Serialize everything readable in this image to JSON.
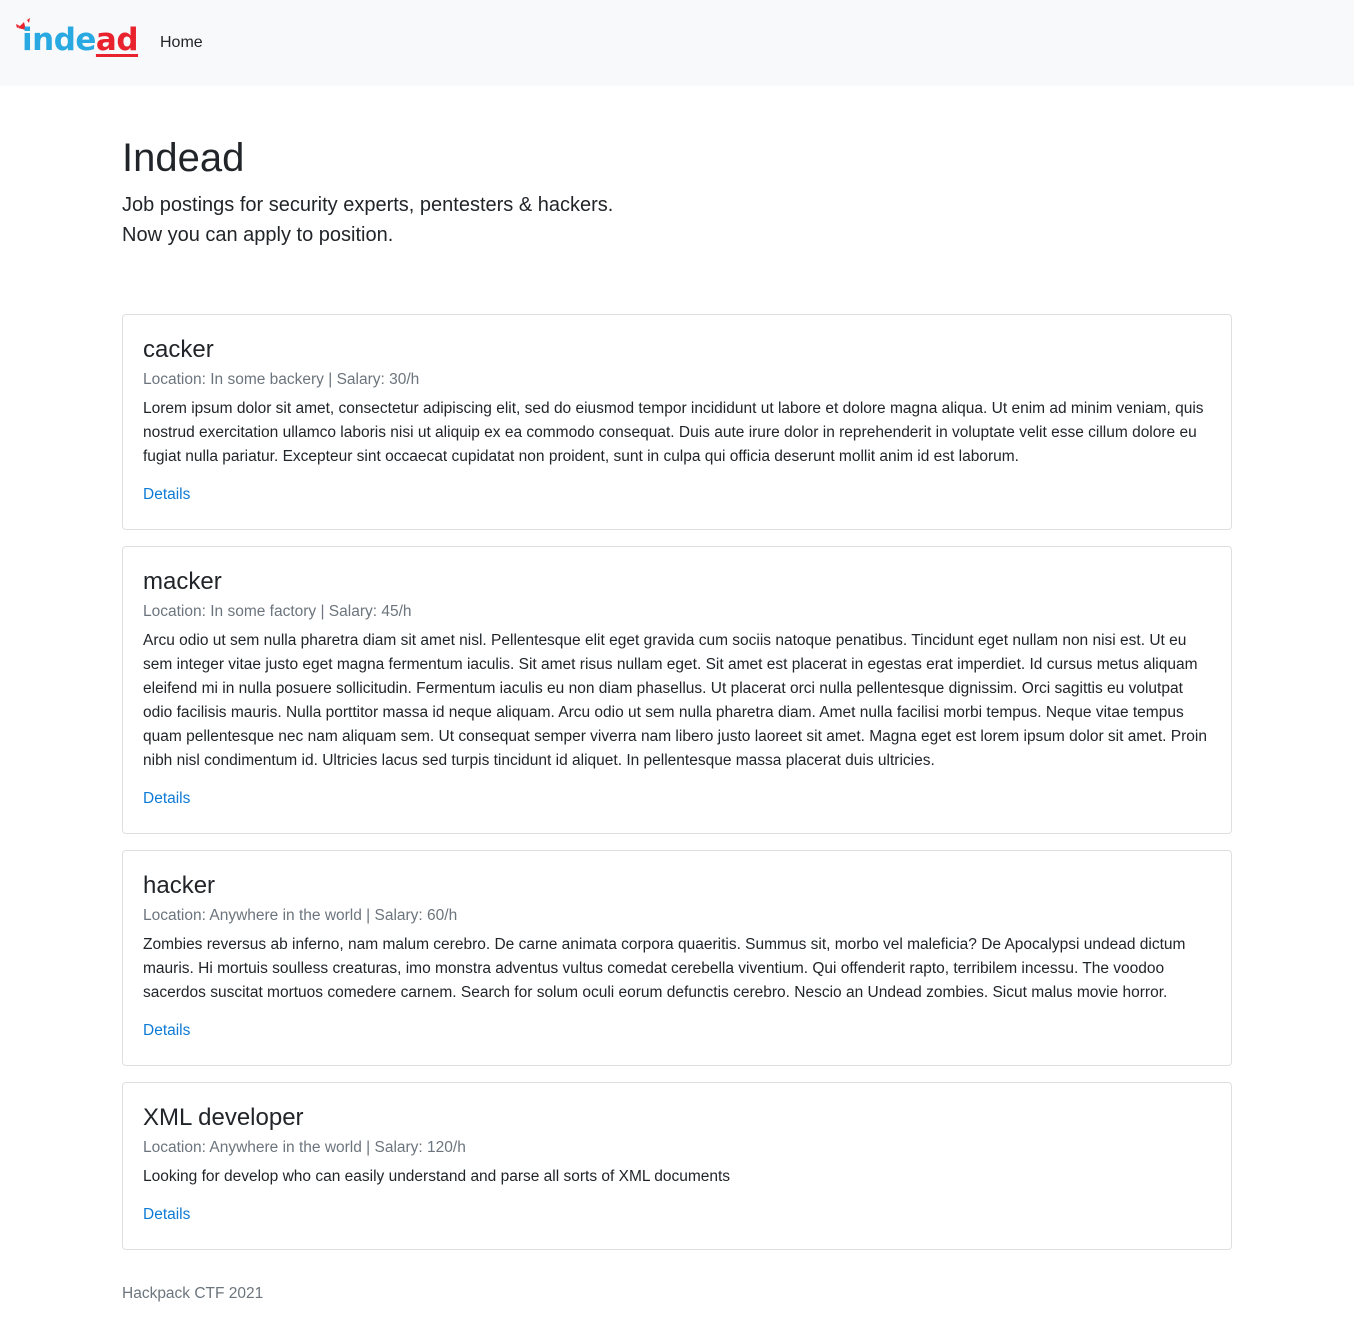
{
  "nav": {
    "brand_part_a": "inde",
    "brand_part_b": "ad",
    "brand_part_c": "",
    "home_label": "Home"
  },
  "header": {
    "title": "Indead",
    "lead_line_1": "Job postings for security experts, pentesters & hackers.",
    "lead_line_2": "Now you can apply to position."
  },
  "jobs": [
    {
      "title": "cacker",
      "meta": "Location: In some backery | Salary: 30/h",
      "description": "Lorem ipsum dolor sit amet, consectetur adipiscing elit, sed do eiusmod tempor incididunt ut labore et dolore magna aliqua. Ut enim ad minim veniam, quis nostrud exercitation ullamco laboris nisi ut aliquip ex ea commodo consequat. Duis aute irure dolor in reprehenderit in voluptate velit esse cillum dolore eu fugiat nulla pariatur. Excepteur sint occaecat cupidatat non proident, sunt in culpa qui officia deserunt mollit anim id est laborum.",
      "link": "Details"
    },
    {
      "title": "macker",
      "meta": "Location: In some factory | Salary: 45/h",
      "description": "Arcu odio ut sem nulla pharetra diam sit amet nisl. Pellentesque elit eget gravida cum sociis natoque penatibus. Tincidunt eget nullam non nisi est. Ut eu sem integer vitae justo eget magna fermentum iaculis. Sit amet risus nullam eget. Sit amet est placerat in egestas erat imperdiet. Id cursus metus aliquam eleifend mi in nulla posuere sollicitudin. Fermentum iaculis eu non diam phasellus. Ut placerat orci nulla pellentesque dignissim. Orci sagittis eu volutpat odio facilisis mauris. Nulla porttitor massa id neque aliquam. Arcu odio ut sem nulla pharetra diam. Amet nulla facilisi morbi tempus. Neque vitae tempus quam pellentesque nec nam aliquam sem. Ut consequat semper viverra nam libero justo laoreet sit amet. Magna eget est lorem ipsum dolor sit amet. Proin nibh nisl condimentum id. Ultricies lacus sed turpis tincidunt id aliquet. In pellentesque massa placerat duis ultricies.",
      "link": "Details"
    },
    {
      "title": "hacker",
      "meta": "Location: Anywhere in the world | Salary: 60/h",
      "description": "Zombies reversus ab inferno, nam malum cerebro. De carne animata corpora quaeritis. Summus sit, morbo vel maleficia? De Apocalypsi undead dictum mauris. Hi mortuis soulless creaturas, imo monstra adventus vultus comedat cerebella viventium. Qui offenderit rapto, terribilem incessu. The voodoo sacerdos suscitat mortuos comedere carnem. Search for solum oculi eorum defunctis cerebro. Nescio an Undead zombies. Sicut malus movie horror.",
      "link": "Details"
    },
    {
      "title": "XML developer",
      "meta": "Location: Anywhere in the world | Salary: 120/h",
      "description": "Looking for develop who can easily understand and parse all sorts of XML documents",
      "link": "Details"
    }
  ],
  "footer": {
    "text": "Hackpack CTF 2021"
  },
  "colors": {
    "brand_blue": "#29a9e1",
    "brand_red": "#e8232d",
    "link": "#0d7ad6",
    "muted": "#6c757d",
    "navbar_bg": "#f8f9fa"
  }
}
